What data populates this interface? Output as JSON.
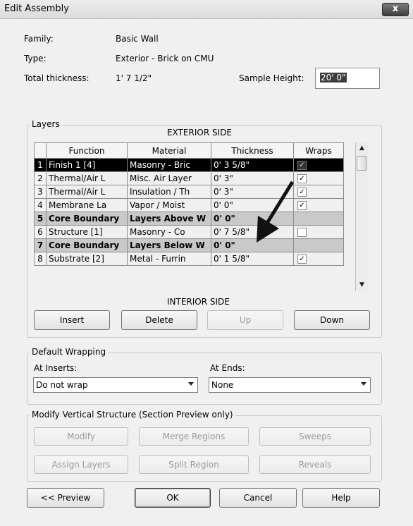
{
  "window": {
    "title": "Edit Assembly",
    "close_label": "x"
  },
  "info": {
    "family_label": "Family:",
    "family_value": "Basic Wall",
    "type_label": "Type:",
    "type_value": "Exterior - Brick on CMU",
    "thickness_label": "Total thickness:",
    "thickness_value": "1'  7 1/2\"",
    "sample_height_label": "Sample Height:",
    "sample_height_value": "20'  0\""
  },
  "layers": {
    "group_title": "Layers",
    "exterior_label": "EXTERIOR SIDE",
    "interior_label": "INTERIOR SIDE",
    "columns": [
      "Function",
      "Material",
      "Thickness",
      "Wraps"
    ],
    "rows": [
      {
        "num": "1",
        "function": "Finish 1 [4]",
        "material": "Masonry - Bric",
        "thickness": "0'  3 5/8\"",
        "wraps": true
      },
      {
        "num": "2",
        "function": "Thermal/Air L",
        "material": "Misc. Air Layer",
        "thickness": "0'  3\"",
        "wraps": true
      },
      {
        "num": "3",
        "function": "Thermal/Air L",
        "material": "Insulation / Th",
        "thickness": "0'  3\"",
        "wraps": true
      },
      {
        "num": "4",
        "function": "Membrane La",
        "material": "Vapor / Moist",
        "thickness": "0'  0\"",
        "wraps": true
      },
      {
        "num": "5",
        "function": "Core Boundary",
        "material": "Layers Above W",
        "thickness": "0'  0\"",
        "wraps": null
      },
      {
        "num": "6",
        "function": "Structure [1]",
        "material": "Masonry - Co",
        "thickness": "0'  7 5/8\"",
        "wraps": false
      },
      {
        "num": "7",
        "function": "Core Boundary",
        "material": "Layers Below W",
        "thickness": "0'  0\"",
        "wraps": null
      },
      {
        "num": "8",
        "function": "Substrate [2]",
        "material": "Metal - Furrin",
        "thickness": "0'  1 5/8\"",
        "wraps": true
      }
    ],
    "check_glyph": "✓",
    "buttons": {
      "insert": "Insert",
      "delete": "Delete",
      "up": "Up",
      "down": "Down"
    }
  },
  "wrapping": {
    "group_title": "Default Wrapping",
    "inserts_label": "At Inserts:",
    "inserts_value": "Do not wrap",
    "ends_label": "At Ends:",
    "ends_value": "None"
  },
  "modify": {
    "group_title": "Modify Vertical Structure (Section Preview only)",
    "buttons": {
      "modify": "Modify",
      "merge": "Merge Regions",
      "sweeps": "Sweeps",
      "assign": "Assign Layers",
      "split": "Split Region",
      "reveals": "Reveals"
    }
  },
  "footer": {
    "preview": "<< Preview",
    "ok": "OK",
    "cancel": "Cancel",
    "help": "Help"
  },
  "colors": {
    "selected_row": "#000000",
    "core_row": "#c9c9c9",
    "arrow": "#111111"
  }
}
